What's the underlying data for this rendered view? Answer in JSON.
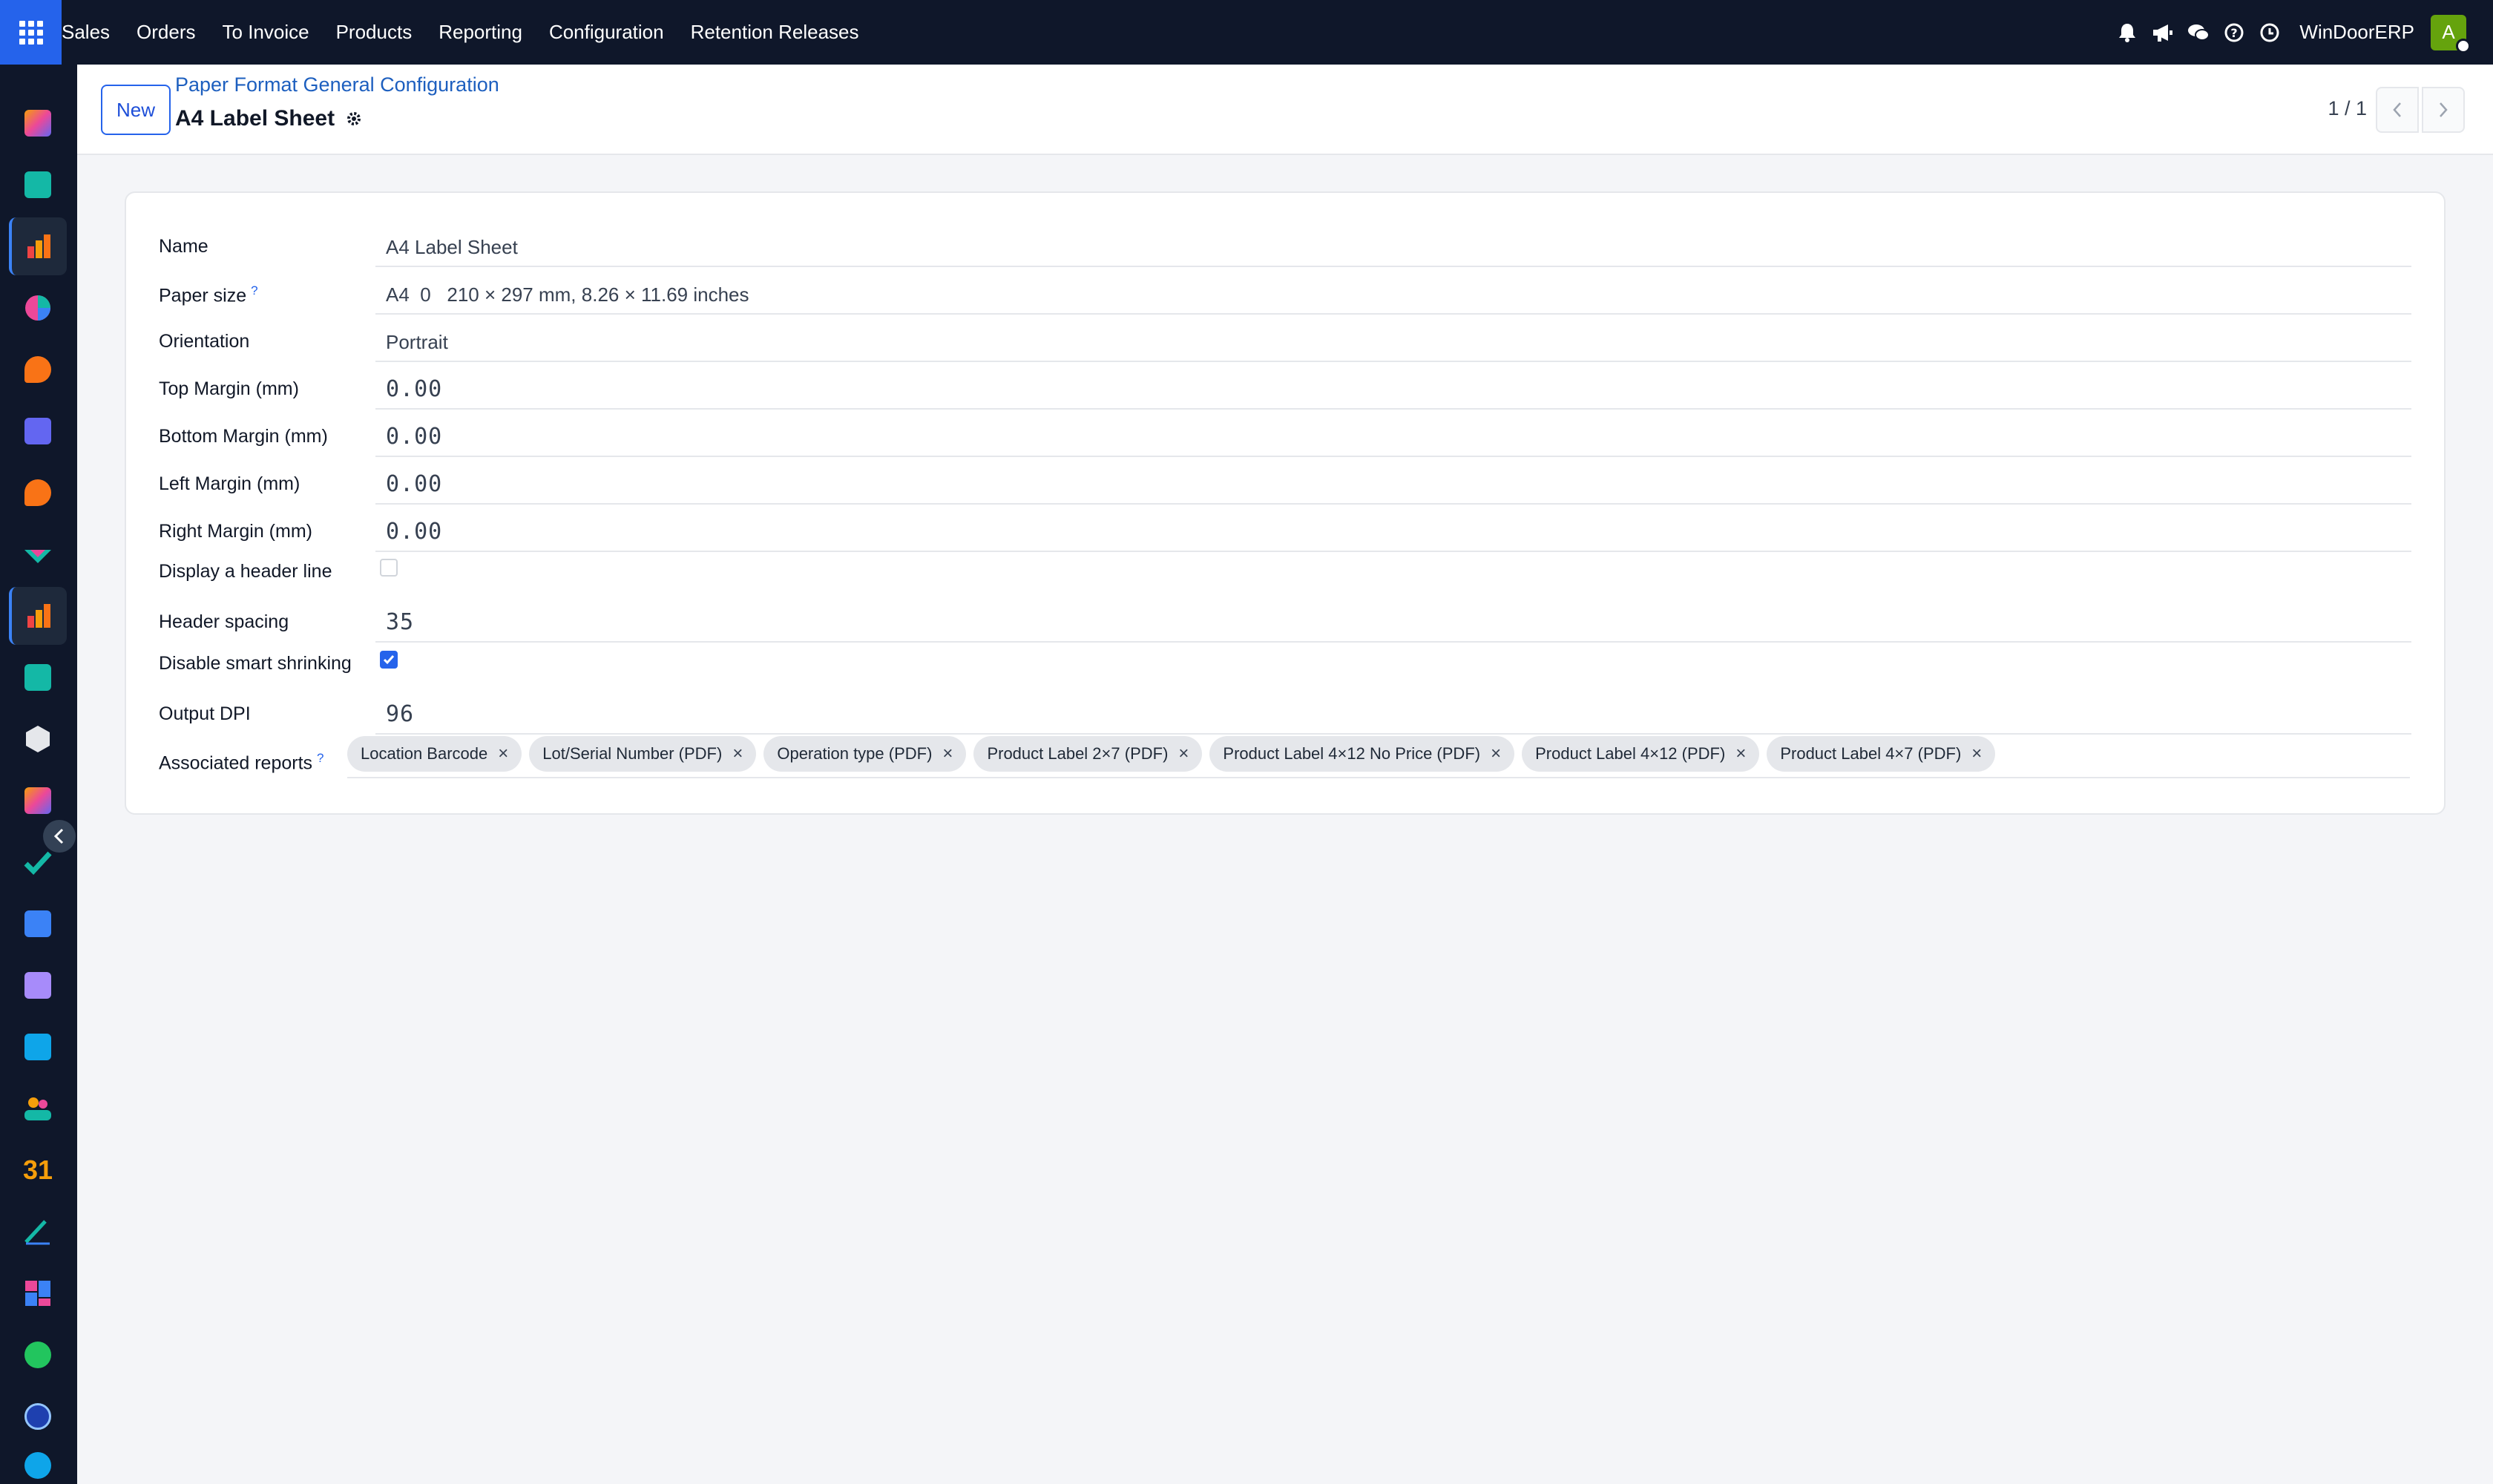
{
  "topbar": {
    "menu": [
      "Sales",
      "Orders",
      "To Invoice",
      "Products",
      "Reporting",
      "Configuration",
      "Retention Releases"
    ],
    "company": "WinDoorERP",
    "avatar_initial": "A",
    "icons": [
      "bell-icon",
      "megaphone-icon",
      "chat-icon",
      "help-icon",
      "clock-icon"
    ]
  },
  "sidebar": {
    "icons": [
      "app-icon-photos",
      "app-icon-contacts",
      "app-icon-sales-active",
      "app-icon-pie",
      "app-icon-chat-orange",
      "app-icon-mail",
      "app-icon-chat-orange-2",
      "app-icon-inventory",
      "app-icon-sales-2-active",
      "app-icon-contacts-2",
      "app-icon-cube",
      "app-icon-photos-2",
      "app-icon-tasks",
      "app-icon-knowledge",
      "app-icon-box",
      "app-icon-invoicing",
      "app-icon-employees",
      "app-icon-calendar",
      "app-icon-sign",
      "app-icon-dashboards",
      "app-icon-whatsapp",
      "app-icon-timer",
      "app-icon-discuss"
    ],
    "calendar_number": "31"
  },
  "control_panel": {
    "new_label": "New",
    "breadcrumb": "Paper Format General Configuration",
    "title": "A4 Label Sheet",
    "pager": "1 / 1"
  },
  "form": {
    "name_label": "Name",
    "name_value": "A4 Label Sheet",
    "paper_size_label": "Paper size",
    "paper_size_help": "?",
    "paper_size_value": "A4  0   210 × 297 mm, 8.26 × 11.69 inches",
    "orientation_label": "Orientation",
    "orientation_value": "Portrait",
    "top_margin_label": "Top Margin (mm)",
    "top_margin_value": "0.00",
    "bottom_margin_label": "Bottom Margin (mm)",
    "bottom_margin_value": "0.00",
    "left_margin_label": "Left Margin (mm)",
    "left_margin_value": "0.00",
    "right_margin_label": "Right Margin (mm)",
    "right_margin_value": "0.00",
    "header_line_label": "Display a header line",
    "header_line_checked": false,
    "header_spacing_label": "Header spacing",
    "header_spacing_value": "35",
    "smart_shrink_label": "Disable smart shrinking",
    "smart_shrink_checked": true,
    "dpi_label": "Output DPI",
    "dpi_value": "96",
    "reports_label": "Associated reports",
    "reports_help": "?",
    "reports": [
      "Location Barcode",
      "Lot/Serial Number (PDF)",
      "Operation type (PDF)",
      "Product Label 2×7 (PDF)",
      "Product Label 4×12 No Price (PDF)",
      "Product Label 4×12 (PDF)",
      "Product Label 4×7 (PDF)"
    ]
  },
  "colors": {
    "topbar": "#0f172a",
    "accent": "#2563eb",
    "link": "#1d5fbf"
  }
}
